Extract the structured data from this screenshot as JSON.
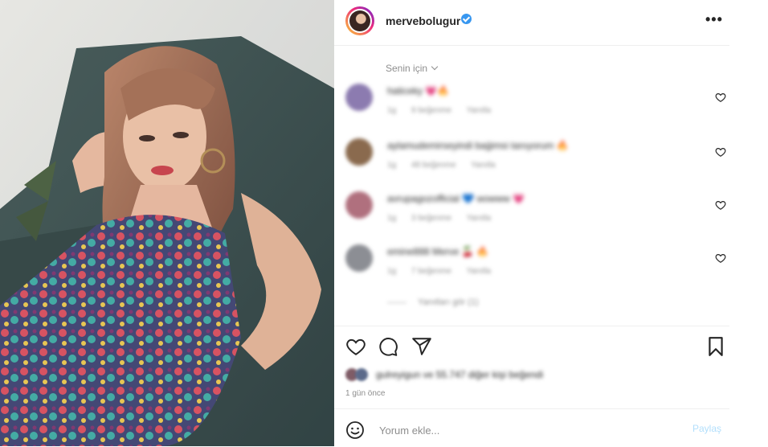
{
  "post": {
    "username": "mervebolugur",
    "verified": true,
    "more_icon": "ellipsis-icon"
  },
  "comments_section": {
    "filter_label": "Senin için",
    "comments": [
      {
        "text": "haticeky 💗🔥",
        "meta": [
          "1g",
          "9 beğenme",
          "Yanıtla"
        ],
        "avatar_color": "#8c7bb0"
      },
      {
        "text": "aylamudemirseyindi baģimsi tanıyorum 🔥",
        "meta": [
          "1g",
          "48 beğenme",
          "Yanıtla"
        ],
        "avatar_color": "#8a6a4e"
      },
      {
        "text": "avrupagozofficial 💙 wowww 💗",
        "meta": [
          "1g",
          "3 beğenme",
          "Yanıtla"
        ],
        "avatar_color": "#b0707e"
      },
      {
        "text": "emine888 Merve 🍒 🔥",
        "meta": [
          "1g",
          "7 beğenme",
          "Yanıtla"
        ],
        "avatar_color": "#8c8e94"
      }
    ],
    "view_replies": "Yanıtları gör (1)"
  },
  "likes": {
    "text": "gulreyigun ve 55.747 diğer kişi beğendi"
  },
  "timestamp": "1 gün önce",
  "composer": {
    "placeholder": "Yorum ekle...",
    "post_label": "Paylaş"
  },
  "colors": {
    "text": "#262626",
    "muted": "#8e8e8e",
    "verified": "#3897f0",
    "post_disabled": "#b2dffc"
  }
}
